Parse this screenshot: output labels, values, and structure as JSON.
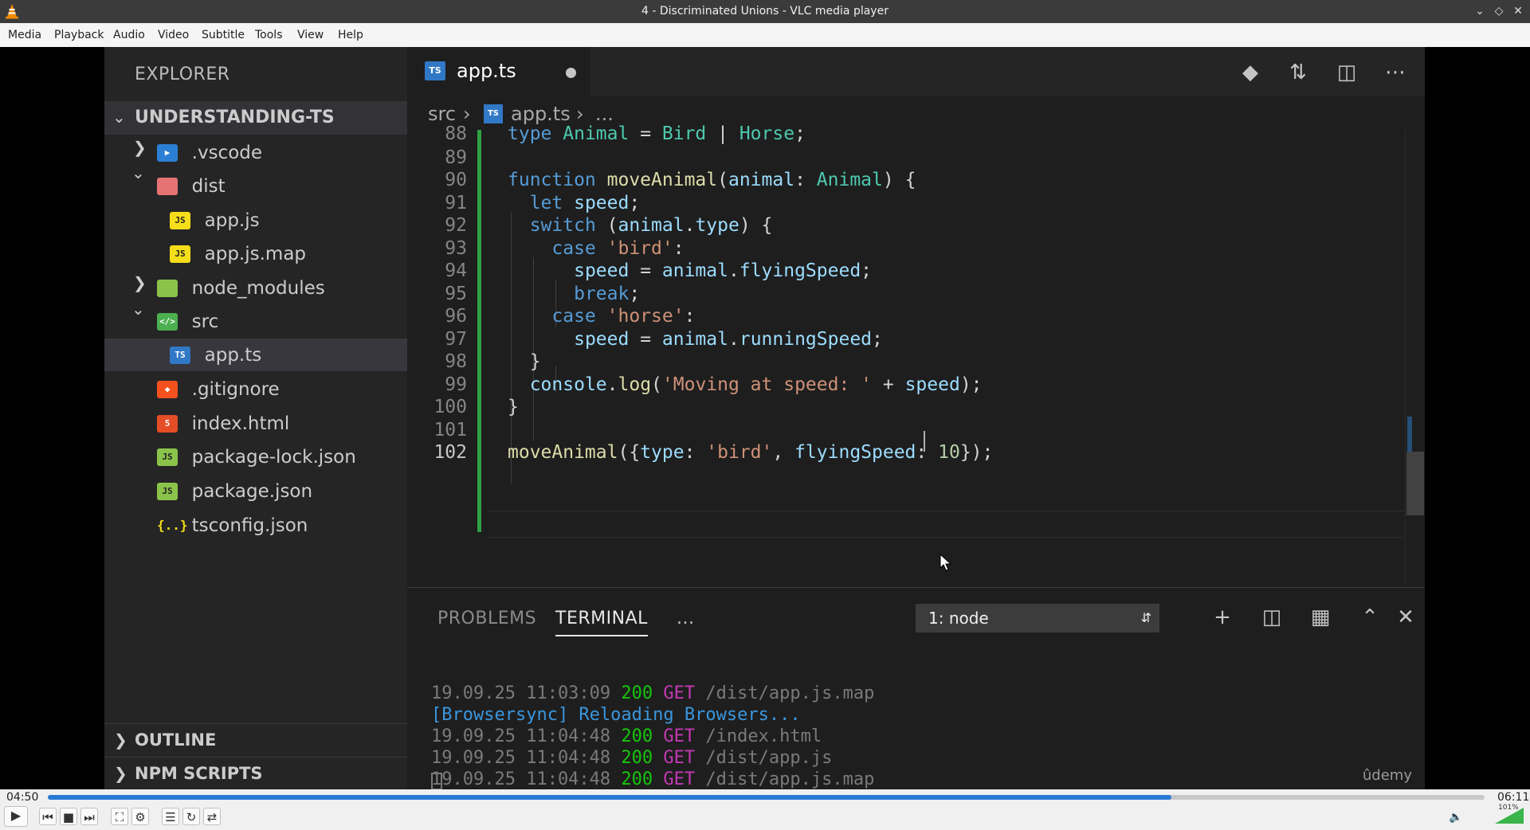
{
  "window": {
    "title": "4 - Discriminated Unions - VLC media player",
    "controls": [
      "minimize-icon",
      "maximize-icon",
      "close-icon"
    ]
  },
  "menubar": {
    "items": [
      "Media",
      "Playback",
      "Audio",
      "Video",
      "Subtitle",
      "Tools",
      "View",
      "Help"
    ]
  },
  "vscode": {
    "sidebar": {
      "header": "EXPLORER",
      "root": "UNDERSTANDING-TS",
      "tree": [
        {
          "label": ".vscode",
          "icon": "folder-vscode-icon",
          "kind": "folder-collapsed"
        },
        {
          "label": "dist",
          "icon": "folder-dist-icon",
          "kind": "folder-open"
        },
        {
          "label": "app.js",
          "icon": "js-file-icon",
          "kind": "file"
        },
        {
          "label": "app.js.map",
          "icon": "js-map-file-icon",
          "kind": "file"
        },
        {
          "label": "node_modules",
          "icon": "folder-node-icon",
          "kind": "folder-collapsed"
        },
        {
          "label": "src",
          "icon": "folder-src-icon",
          "kind": "folder-open"
        },
        {
          "label": "app.ts",
          "icon": "ts-file-icon",
          "kind": "file-selected"
        },
        {
          "label": ".gitignore",
          "icon": "git-file-icon",
          "kind": "file"
        },
        {
          "label": "index.html",
          "icon": "html-file-icon",
          "kind": "file"
        },
        {
          "label": "package-lock.json",
          "icon": "node-json-file-icon",
          "kind": "file"
        },
        {
          "label": "package.json",
          "icon": "node-json-file-icon",
          "kind": "file"
        },
        {
          "label": "tsconfig.json",
          "icon": "json-file-icon",
          "kind": "file"
        }
      ],
      "outline": "OUTLINE",
      "npm_scripts": "NPM SCRIPTS"
    },
    "tab": {
      "label": "app.ts",
      "icon_text": "TS",
      "dirty": true
    },
    "breadcrumbs": {
      "folder": "src",
      "file": "app.ts",
      "more": "..."
    },
    "code": {
      "line_numbers": [
        "88",
        "89",
        "90",
        "91",
        "92",
        "93",
        "94",
        "95",
        "96",
        "97",
        "98",
        "99",
        "100",
        "101",
        "102"
      ],
      "current_line": "102"
    },
    "panel": {
      "tabs": [
        "PROBLEMS",
        "TERMINAL",
        "..."
      ],
      "active_tab": "TERMINAL",
      "terminal_select": "1: node",
      "lines": [
        {
          "date": "19.09.25 11:03:09",
          "code": "200",
          "method": "GET",
          "path": "/dist/app.js.map"
        },
        {
          "bs": "[Browsersync] Reloading Browsers..."
        },
        {
          "date": "19.09.25 11:04:48",
          "code": "200",
          "method": "GET",
          "path": "/index.html"
        },
        {
          "date": "19.09.25 11:04:48",
          "code": "200",
          "method": "GET",
          "path": "/dist/app.js"
        },
        {
          "date": "19.09.25 11:04:48",
          "code": "200",
          "method": "GET",
          "path": "/dist/app.js.map"
        }
      ]
    },
    "watermark": "ûdemy"
  },
  "player": {
    "elapsed": "04:50",
    "total": "06:11",
    "progress": 0.782,
    "volume_percent": "101%",
    "volume_level": 1.01
  },
  "colors": {
    "accent": "#2a7ad5",
    "ts_blue": "#3178c6",
    "git_added": "#2ea043"
  }
}
